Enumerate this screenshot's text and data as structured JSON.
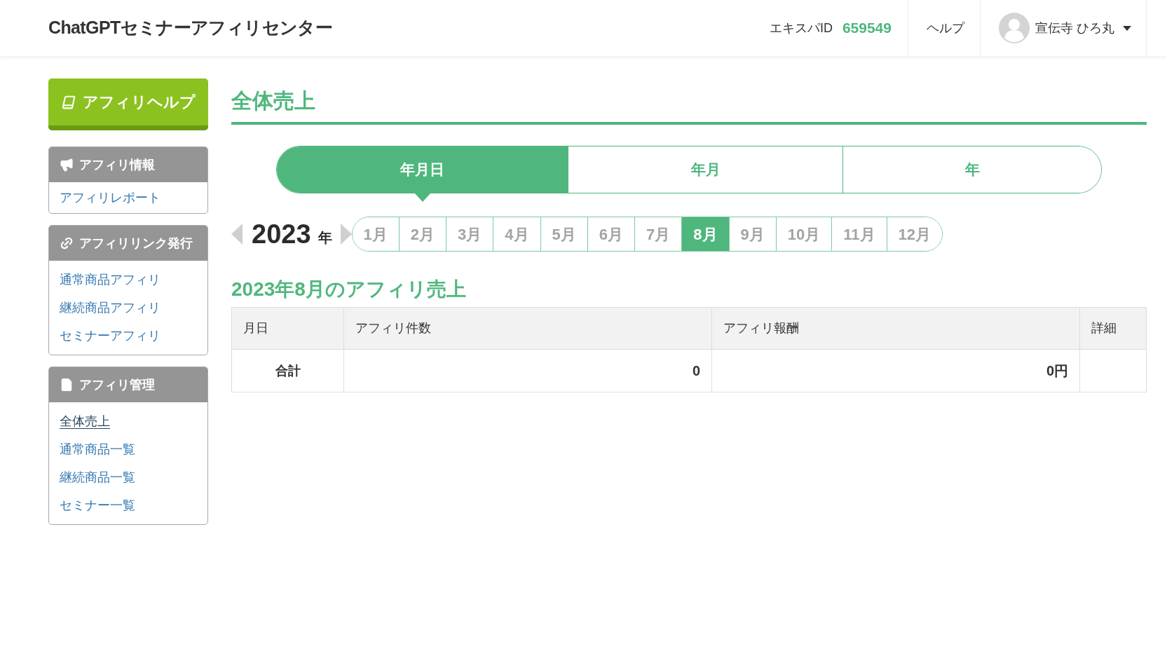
{
  "header": {
    "title": "ChatGPTセミナーアフィリセンター",
    "expa_id_label": "エキスパID",
    "expa_id": "659549",
    "help_link": "ヘルプ",
    "user_name": "宣伝寺 ひろ丸"
  },
  "sidebar": {
    "help_button": "アフィリヘルプ",
    "panels": [
      {
        "kind": "info",
        "title": "アフィリ情報",
        "items": [
          {
            "label": "アフィリレポート",
            "selected": false
          }
        ]
      },
      {
        "kind": "link",
        "title": "アフィリリンク発行",
        "items": [
          {
            "label": "通常商品アフィリ",
            "selected": false
          },
          {
            "label": "継続商品アフィリ",
            "selected": false
          },
          {
            "label": "セミナーアフィリ",
            "selected": false
          }
        ]
      },
      {
        "kind": "manage",
        "title": "アフィリ管理",
        "items": [
          {
            "label": "全体売上",
            "selected": true
          },
          {
            "label": "通常商品一覧",
            "selected": false
          },
          {
            "label": "継続商品一覧",
            "selected": false
          },
          {
            "label": "セミナー一覧",
            "selected": false
          }
        ]
      }
    ]
  },
  "main": {
    "title": "全体売上",
    "period_tabs": [
      {
        "label": "年月日",
        "selected": true
      },
      {
        "label": "年月",
        "selected": false
      },
      {
        "label": "年",
        "selected": false
      }
    ],
    "year": "2023",
    "year_unit": "年",
    "months": [
      {
        "label": "1月",
        "selected": false
      },
      {
        "label": "2月",
        "selected": false
      },
      {
        "label": "3月",
        "selected": false
      },
      {
        "label": "4月",
        "selected": false
      },
      {
        "label": "5月",
        "selected": false
      },
      {
        "label": "6月",
        "selected": false
      },
      {
        "label": "7月",
        "selected": false
      },
      {
        "label": "8月",
        "selected": true
      },
      {
        "label": "9月",
        "selected": false
      },
      {
        "label": "10月",
        "selected": false
      },
      {
        "label": "11月",
        "selected": false
      },
      {
        "label": "12月",
        "selected": false
      }
    ],
    "section_title": "2023年8月のアフィリ売上",
    "table": {
      "columns": [
        "月日",
        "アフィリ件数",
        "アフィリ報酬",
        "詳細"
      ],
      "rows": [
        {
          "label": "合計",
          "count": "0",
          "reward": "0円"
        }
      ]
    }
  }
}
